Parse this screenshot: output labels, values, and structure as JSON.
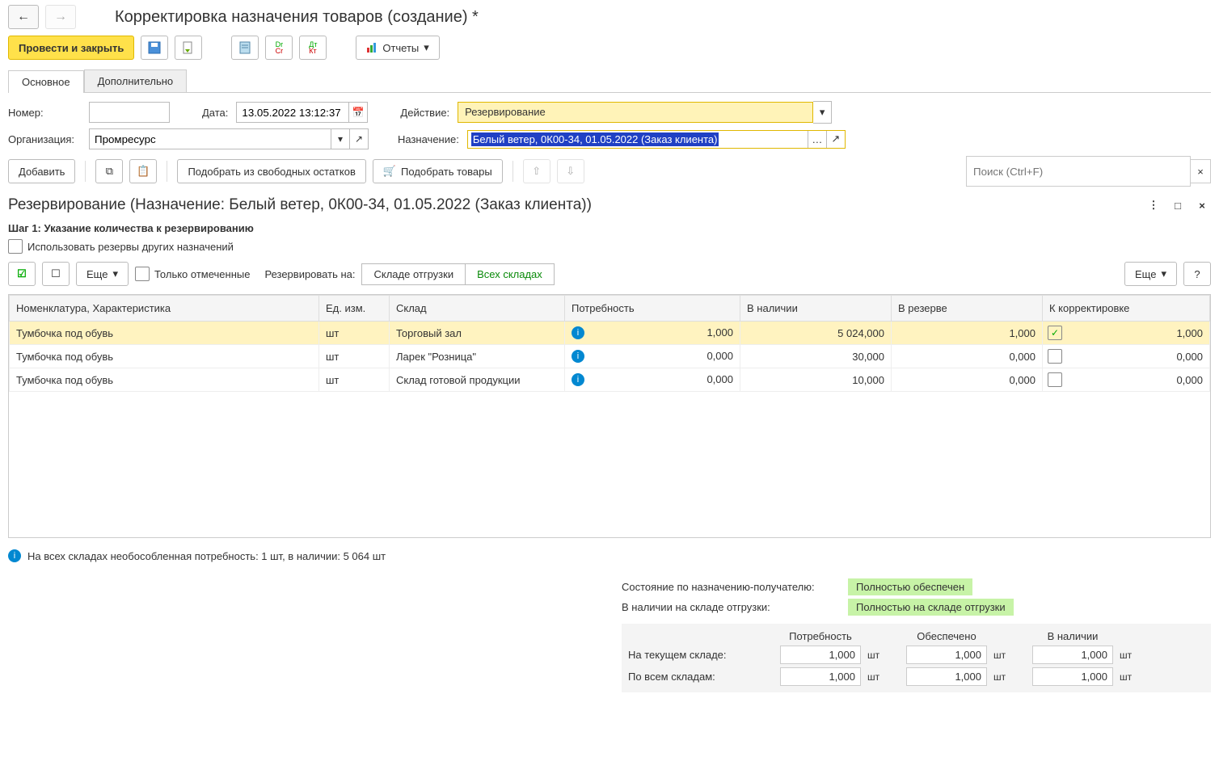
{
  "title": "Корректировка назначения товаров (создание) *",
  "toolbar": {
    "post_and_close": "Провести и закрыть",
    "reports": "Отчеты"
  },
  "tabs": {
    "main": "Основное",
    "extra": "Дополнительно"
  },
  "form": {
    "number_label": "Номер:",
    "number_value": "",
    "date_label": "Дата:",
    "date_value": "13.05.2022 13:12:37",
    "action_label": "Действие:",
    "action_value": "Резервирование",
    "org_label": "Организация:",
    "org_value": "Промресурс",
    "assign_label": "Назначение:",
    "assign_value": "Белый ветер, 0К00-34, 01.05.2022 (Заказ клиента)"
  },
  "toolbar2": {
    "add": "Добавить",
    "pick_free": "Подобрать из свободных остатков",
    "pick_goods": "Подобрать товары",
    "search_placeholder": "Поиск (Ctrl+F)"
  },
  "dialog": {
    "title": "Резервирование (Назначение: Белый ветер, 0К00-34, 01.05.2022 (Заказ клиента))",
    "step": "Шаг 1: Указание количества к резервированию",
    "use_other": "Использовать резервы других назначений",
    "more": "Еще",
    "only_checked": "Только отмеченные",
    "reserve_on": "Резервировать на:",
    "seg_ship": "Складе отгрузки",
    "seg_all": "Всех складах",
    "help": "?"
  },
  "grid": {
    "headers": {
      "nomen": "Номенклатура, Характеристика",
      "unit": "Ед. изм.",
      "warehouse": "Склад",
      "need": "Потребность",
      "avail": "В наличии",
      "reserve": "В резерве",
      "correct": "К корректировке"
    },
    "rows": [
      {
        "nomen": "Тумбочка под обувь",
        "unit": "шт",
        "warehouse": "Торговый зал",
        "need": "1,000",
        "avail": "5 024,000",
        "reserve": "1,000",
        "correct": "1,000",
        "checked": true,
        "highlight": true
      },
      {
        "nomen": "Тумбочка под обувь",
        "unit": "шт",
        "warehouse": "Ларек \"Розница\"",
        "need": "0,000",
        "avail": "30,000",
        "reserve": "0,000",
        "correct": "0,000",
        "checked": false,
        "highlight": false
      },
      {
        "nomen": "Тумбочка под обувь",
        "unit": "шт",
        "warehouse": "Склад готовой продукции",
        "need": "0,000",
        "avail": "10,000",
        "reserve": "0,000",
        "correct": "0,000",
        "checked": false,
        "highlight": false
      }
    ]
  },
  "info_footer": "На всех складах необособленная потребность: 1 шт, в наличии: 5 064 шт",
  "status": {
    "label1": "Состояние по назначению-получателю:",
    "value1": "Полностью обеспечен",
    "label2": "В наличии на складе отгрузки:",
    "value2": "Полностью на складе отгрузки"
  },
  "summary": {
    "headers": {
      "need": "Потребность",
      "secured": "Обеспечено",
      "avail": "В наличии"
    },
    "rows": [
      {
        "label": "На текущем складе:",
        "need": "1,000",
        "secured": "1,000",
        "avail": "1,000",
        "unit": "шт"
      },
      {
        "label": "По всем складам:",
        "need": "1,000",
        "secured": "1,000",
        "avail": "1,000",
        "unit": "шт"
      }
    ]
  }
}
